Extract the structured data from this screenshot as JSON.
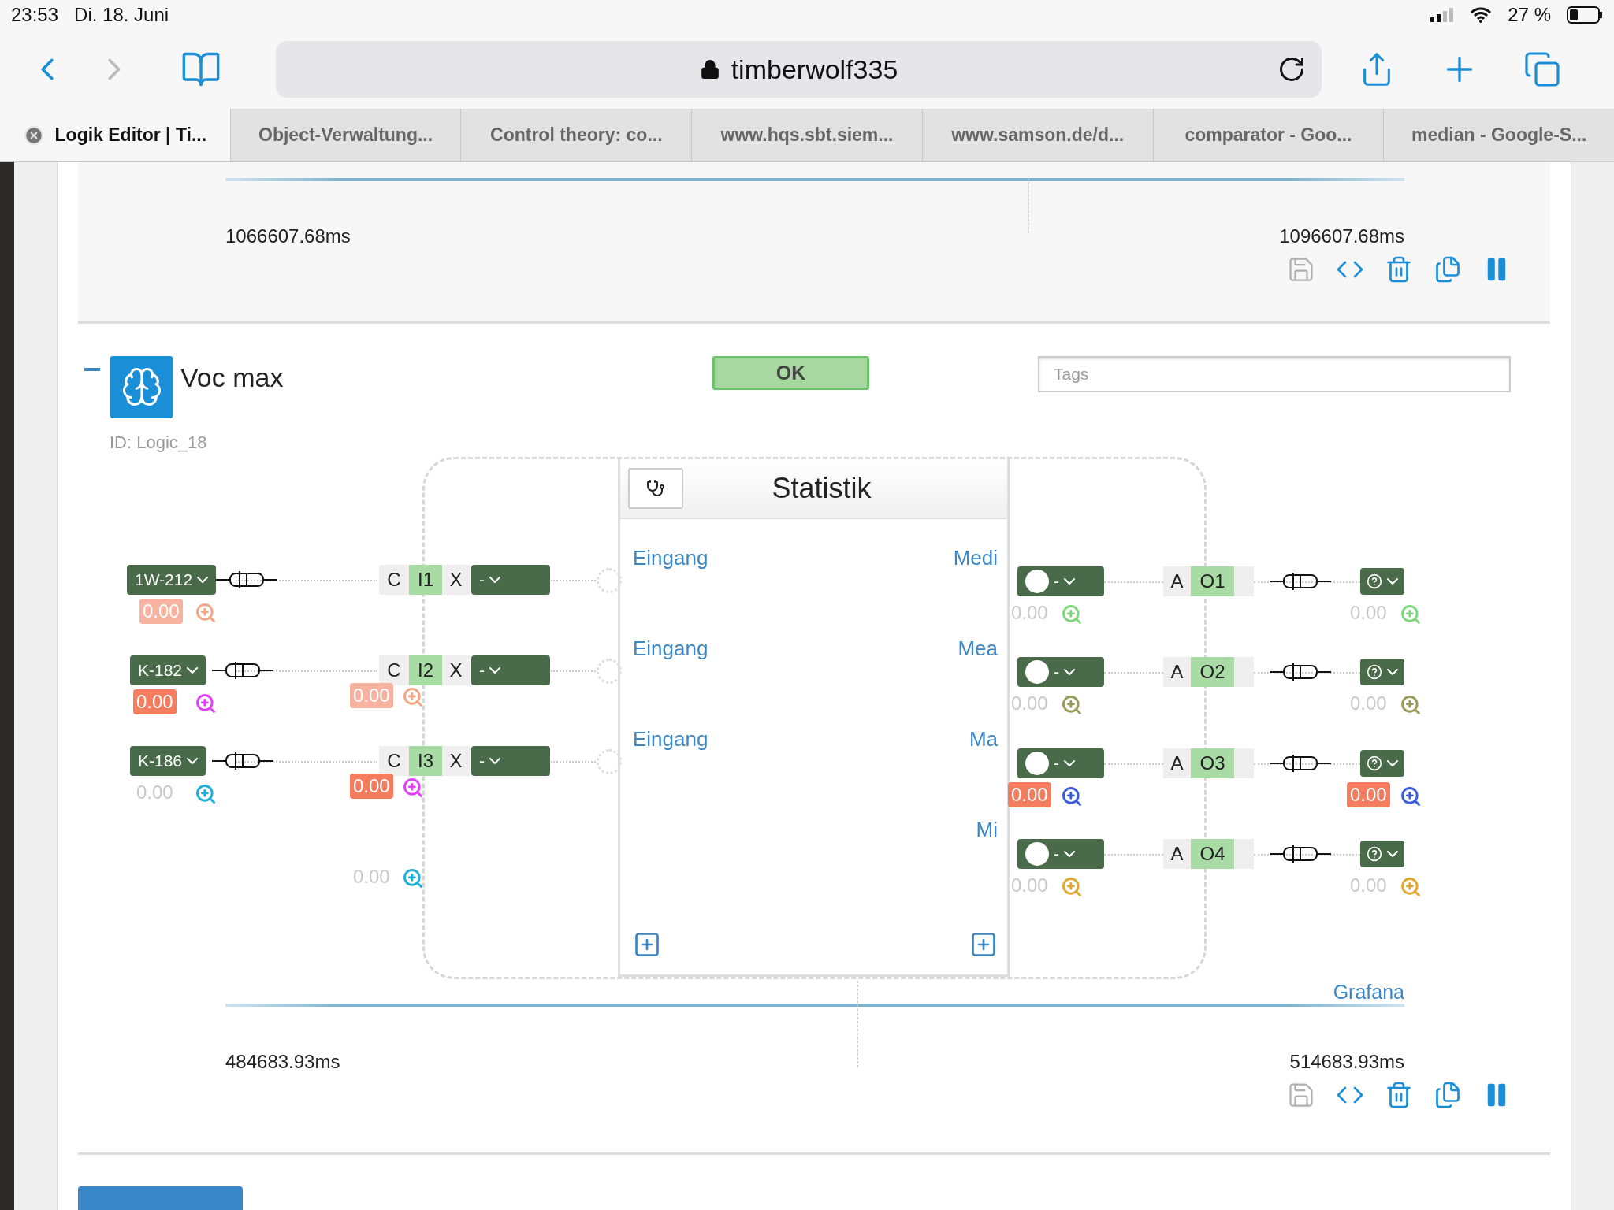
{
  "status_bar": {
    "time": "23:53",
    "date": "Di. 18. Juni",
    "battery": "27 %"
  },
  "browser": {
    "url": "timberwolf335",
    "tabs": [
      {
        "label": "Logik Editor | Ti...",
        "selected": true
      },
      {
        "label": "Object-Verwaltung...",
        "selected": false
      },
      {
        "label": "Control theory: co...",
        "selected": false
      },
      {
        "label": "www.hqs.sbt.siem...",
        "selected": false
      },
      {
        "label": "www.samson.de/d...",
        "selected": false
      },
      {
        "label": "comparator - Goo...",
        "selected": false
      },
      {
        "label": "median - Google-S...",
        "selected": false
      }
    ]
  },
  "previous_block": {
    "timeline": {
      "start": "1066607.68ms",
      "end": "1096607.68ms"
    }
  },
  "block": {
    "title": "Voc max",
    "status": "OK",
    "tags": {
      "placeholder": "Tags"
    },
    "id": "ID: Logic_18",
    "module": {
      "title": "Statistik",
      "inputs": [
        "Eingang",
        "Eingang",
        "Eingang"
      ],
      "outputs": [
        "Medi",
        "Mea",
        "Ma",
        "Mi"
      ]
    },
    "input_links": [
      {
        "source": "1W-212",
        "reading": {
          "text": "0.00",
          "kind": "pale",
          "color": "#f4a582"
        },
        "prefix": "C",
        "port": "I1",
        "suffix": "X",
        "selector": "-"
      },
      {
        "source": "K-182",
        "reading": {
          "text": "0.00",
          "kind": "strong",
          "color": "#e040fb"
        },
        "prefix": "C",
        "port": "I2",
        "suffix": "X",
        "selector": "-"
      },
      {
        "source": "K-186",
        "reading": {
          "text": "0.00",
          "kind": "plain",
          "color": "#1ab0d8"
        },
        "prefix": "C",
        "port": "I3",
        "suffix": "X",
        "selector": "-"
      }
    ],
    "input_port_readings": [
      {
        "text": "0.00",
        "kind": "pale",
        "color": "#f4a582"
      },
      {
        "text": "0.00",
        "kind": "strong",
        "color": "#e040fb"
      },
      {
        "text": "0.00",
        "kind": "plain",
        "color": "#1ab0d8"
      }
    ],
    "output_links": [
      {
        "selector": "-",
        "reading": {
          "text": "0.00",
          "kind": "plain",
          "color": "#7ed67e"
        },
        "prefix": "A",
        "port": "O1",
        "target_reading": {
          "text": "0.00",
          "kind": "plain",
          "color": "#7ed67e"
        }
      },
      {
        "selector": "-",
        "reading": {
          "text": "0.00",
          "kind": "plain",
          "color": "#9a9a5a"
        },
        "prefix": "A",
        "port": "O2",
        "target_reading": {
          "text": "0.00",
          "kind": "plain",
          "color": "#9a9a5a"
        }
      },
      {
        "selector": "-",
        "reading": {
          "text": "0.00",
          "kind": "strong",
          "color": "#3b5bdb"
        },
        "prefix": "A",
        "port": "O3",
        "target_reading": {
          "text": "0.00",
          "kind": "strong",
          "color": "#3b5bdb"
        }
      },
      {
        "selector": "-",
        "reading": {
          "text": "0.00",
          "kind": "plain",
          "color": "#e0a82e"
        },
        "prefix": "A",
        "port": "O4",
        "target_reading": {
          "text": "0.00",
          "kind": "plain",
          "color": "#e0a82e"
        }
      }
    ],
    "timeline": {
      "link": "Grafana",
      "start": "484683.93ms",
      "end": "514683.93ms"
    }
  }
}
